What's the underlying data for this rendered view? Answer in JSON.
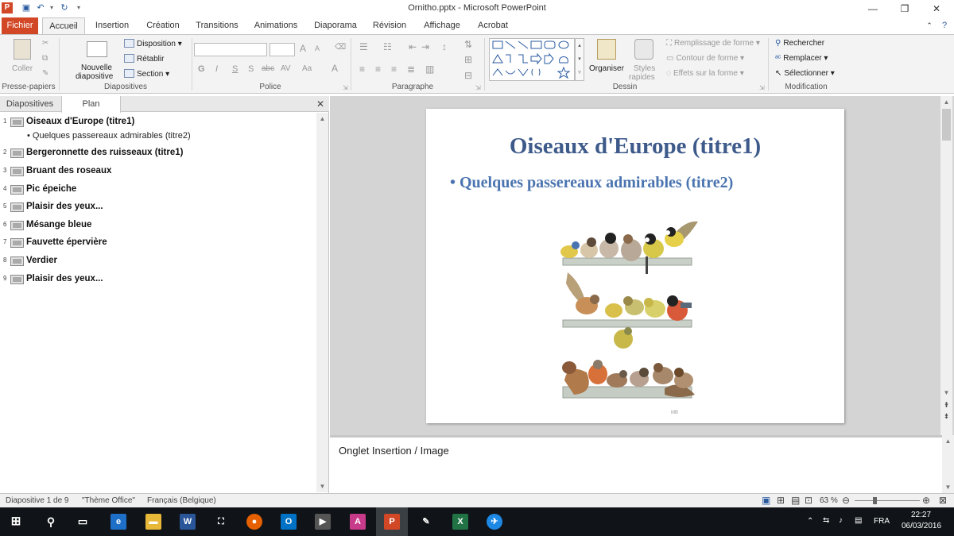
{
  "window": {
    "title": "Ornitho.pptx - Microsoft PowerPoint",
    "minimize": "—",
    "restore": "❐",
    "close": "✕"
  },
  "tabs": [
    {
      "label": "Fichier"
    },
    {
      "label": "Accueil"
    },
    {
      "label": "Insertion"
    },
    {
      "label": "Création"
    },
    {
      "label": "Transitions"
    },
    {
      "label": "Animations"
    },
    {
      "label": "Diaporama"
    },
    {
      "label": "Révision"
    },
    {
      "label": "Affichage"
    },
    {
      "label": "Acrobat"
    }
  ],
  "ribbon": {
    "clipboard": {
      "paste": "Coller",
      "label": "Presse-papiers"
    },
    "slides": {
      "new_slide_1": "Nouvelle",
      "new_slide_2": "diapositive",
      "layout": "Disposition",
      "reset": "Rétablir",
      "section": "Section",
      "label": "Diapositives"
    },
    "font": {
      "label": "Police",
      "bold": "G",
      "italic": "I",
      "underline": "S",
      "shadow": "S",
      "strike": "abc",
      "spacing": "AV",
      "case": "Aa",
      "grow": "A",
      "shrink": "A",
      "color": "A"
    },
    "paragraph": {
      "label": "Paragraphe"
    },
    "drawing": {
      "arrange": "Organiser",
      "quick_styles_1": "Styles",
      "quick_styles_2": "rapides",
      "fill": "Remplissage de forme",
      "outline": "Contour de forme",
      "effects": "Effets sur la forme",
      "label": "Dessin"
    },
    "editing": {
      "find": "Rechercher",
      "replace": "Remplacer",
      "select": "Sélectionner",
      "label": "Modification"
    }
  },
  "left_pane": {
    "tabs": [
      "Diapositives",
      "Plan"
    ],
    "outline": [
      {
        "num": "1",
        "title": "Oiseaux d'Europe (titre1)"
      },
      {
        "num": "2",
        "title": "Bergeronnette des ruisseaux (titre1)"
      },
      {
        "num": "3",
        "title": "Bruant des roseaux"
      },
      {
        "num": "4",
        "title": "Pic épeiche"
      },
      {
        "num": "5",
        "title": "Plaisir des yeux..."
      },
      {
        "num": "6",
        "title": "Mésange bleue"
      },
      {
        "num": "7",
        "title": "Fauvette épervière"
      },
      {
        "num": "8",
        "title": "Verdier"
      },
      {
        "num": "9",
        "title": "Plaisir des yeux..."
      }
    ],
    "sub_bullet": "•  Quelques passereaux admirables (titre2)"
  },
  "slide": {
    "title": "Oiseaux d'Europe (titre1)",
    "bullet": "•  Quelques passereaux admirables (titre2)",
    "signature": "MB"
  },
  "notes": {
    "text": "Onglet Insertion / Image"
  },
  "status": {
    "slide_counter": "Diapositive 1 de 9",
    "theme": "\"Thème Office\"",
    "language": "Français (Belgique)",
    "zoom": "63 %"
  },
  "taskbar": {
    "language": "FRA",
    "time": "22:27",
    "date": "06/03/2016"
  }
}
